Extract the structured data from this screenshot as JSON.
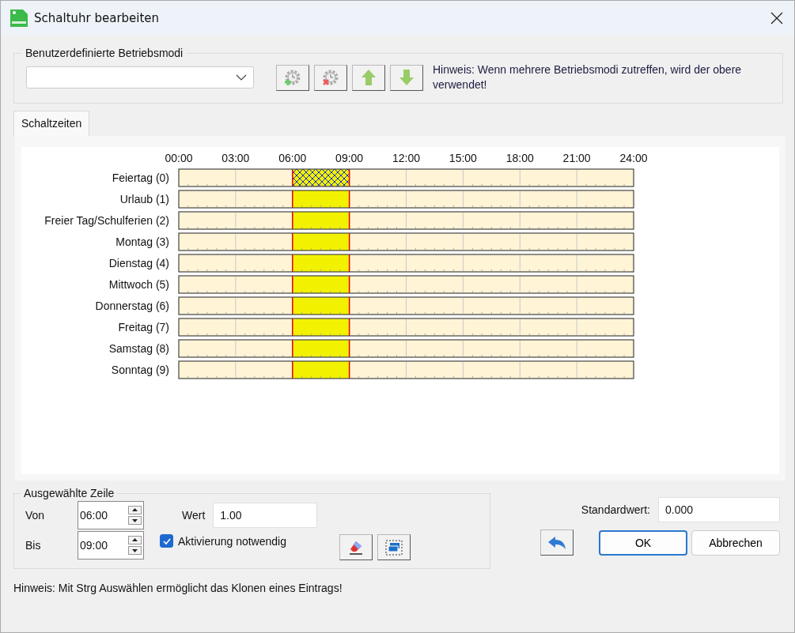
{
  "window": {
    "title": "Schaltuhr bearbeiten"
  },
  "modes_group": {
    "title": "Benutzerdefinierte Betriebsmodi",
    "hint": "Hinweis: Wenn mehrere Betriebsmodi zutreffen, wird der obere verwendet!"
  },
  "tabs": [
    {
      "label": "Schaltzeiten",
      "selected": true
    }
  ],
  "chart_data": {
    "type": "bar",
    "orientation": "horizontal",
    "stacked": true,
    "categories": [
      "Feiertag (0)",
      "Urlaub (1)",
      "Freier Tag/Schulferien (2)",
      "Montag (3)",
      "Dienstag (4)",
      "Mittwoch (5)",
      "Donnerstag (6)",
      "Freitag (7)",
      "Samstag (8)",
      "Sonntag (9)"
    ],
    "xlim": [
      0,
      24
    ],
    "xticks": [
      {
        "value": 0,
        "label": "00:00"
      },
      {
        "value": 3,
        "label": "03:00"
      },
      {
        "value": 6,
        "label": "06:00"
      },
      {
        "value": 9,
        "label": "09:00"
      },
      {
        "value": 12,
        "label": "12:00"
      },
      {
        "value": 15,
        "label": "15:00"
      },
      {
        "value": 18,
        "label": "18:00"
      },
      {
        "value": 21,
        "label": "21:00"
      },
      {
        "value": 24,
        "label": "24:00"
      }
    ],
    "series": [
      {
        "color": "#fff4d6",
        "values": [
          6,
          6,
          6,
          6,
          6,
          6,
          6,
          6,
          6,
          6
        ]
      },
      {
        "color": "#1a2fd0",
        "values": [
          3,
          null,
          null,
          null,
          null,
          null,
          null,
          null,
          null,
          null
        ]
      },
      {
        "color": "#f2f200",
        "values": [
          null,
          3,
          3,
          3,
          3,
          3,
          3,
          3,
          3,
          3
        ]
      },
      {
        "color": "#fff4d6",
        "values": [
          15,
          15,
          15,
          15,
          15,
          15,
          15,
          15,
          15,
          15
        ]
      }
    ]
  },
  "selected_row": {
    "title": "Ausgewählte Zeile",
    "from_label": "Von",
    "from_value": "06:00",
    "to_label": "Bis",
    "to_value": "09:00",
    "value_label": "Wert",
    "value": "1.00",
    "activation": {
      "label": "Aktivierung notwendig",
      "checked": true
    }
  },
  "default_value": {
    "label": "Standardwert:",
    "value": "0.000"
  },
  "buttons": [
    {
      "label": "OK",
      "kind": "default"
    },
    {
      "label": "Abbrechen",
      "kind": "normal"
    }
  ],
  "footer_hint": "Hinweis: Mit Strg Auswählen ermöglicht das Klonen eines Eintrags!"
}
